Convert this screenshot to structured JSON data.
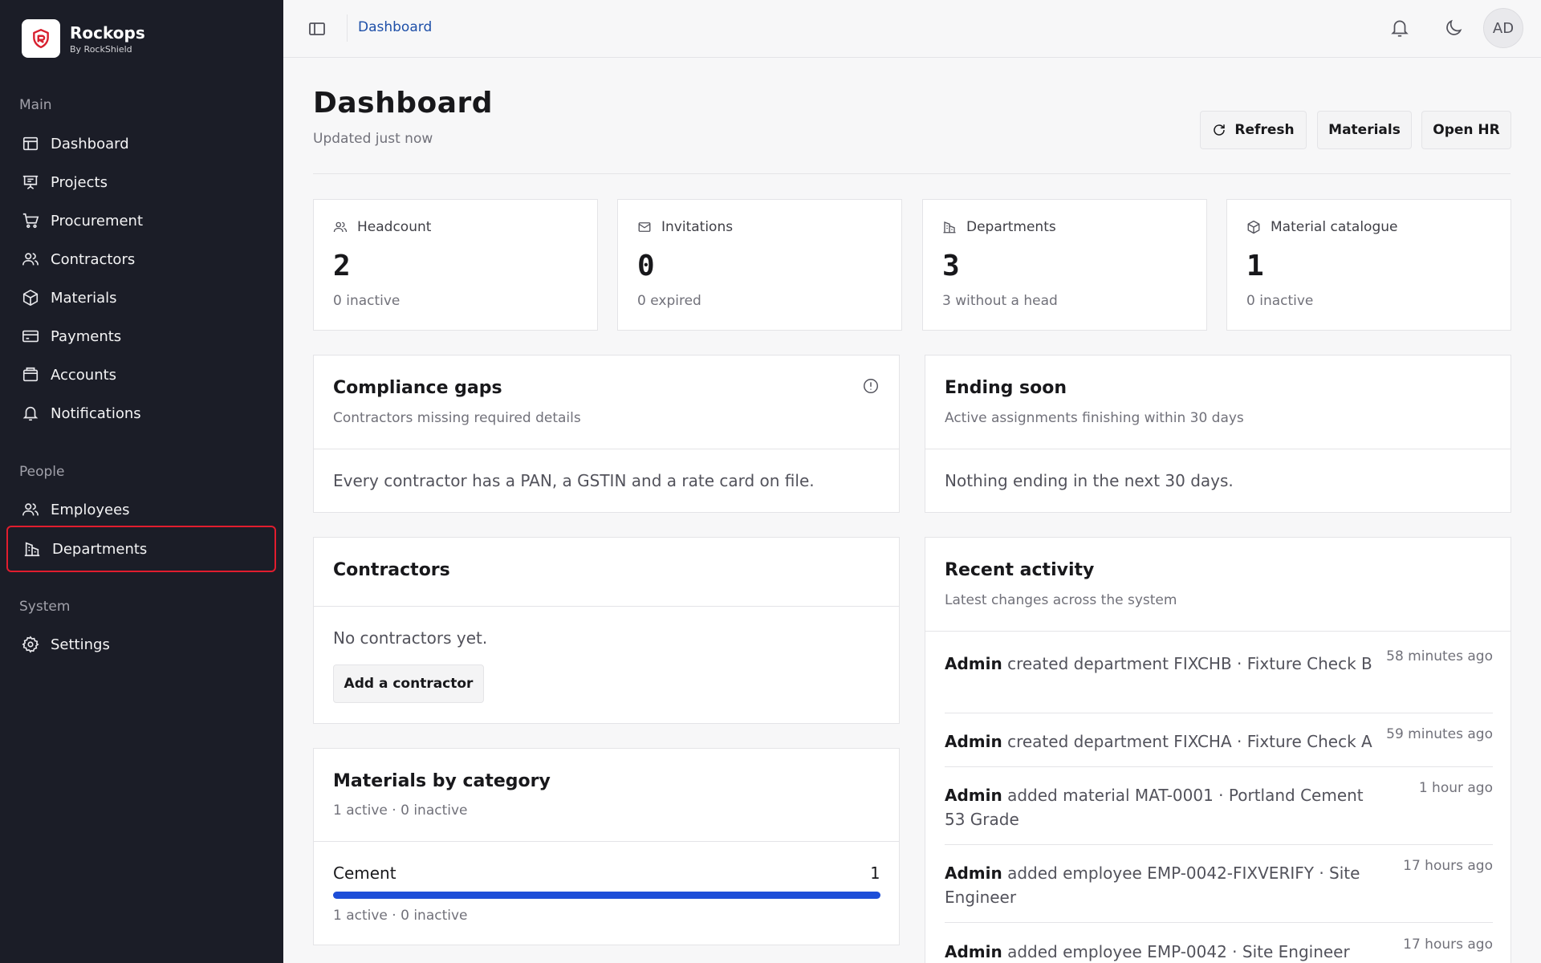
{
  "brand": {
    "name": "Rockops",
    "sub": "By RockShield"
  },
  "sidebar": {
    "sections": [
      {
        "label": "Main"
      },
      {
        "label": "People"
      },
      {
        "label": "System"
      }
    ],
    "items": [
      {
        "label": "Dashboard",
        "icon": "layout-icon"
      },
      {
        "label": "Projects",
        "icon": "presentation-icon"
      },
      {
        "label": "Procurement",
        "icon": "cart-icon"
      },
      {
        "label": "Contractors",
        "icon": "users-icon"
      },
      {
        "label": "Materials",
        "icon": "box-icon"
      },
      {
        "label": "Payments",
        "icon": "card-icon"
      },
      {
        "label": "Accounts",
        "icon": "wallet-icon"
      },
      {
        "label": "Notifications",
        "icon": "bell-icon"
      },
      {
        "label": "Employees",
        "icon": "users-icon"
      },
      {
        "label": "Departments",
        "icon": "building-icon",
        "selected": true
      },
      {
        "label": "Settings",
        "icon": "gear-icon"
      }
    ]
  },
  "topbar": {
    "breadcrumb": "Dashboard",
    "avatar": "AD"
  },
  "header": {
    "title": "Dashboard",
    "subtitle": "Updated just now",
    "buttons": {
      "refresh": "Refresh",
      "materials": "Materials",
      "open_hr": "Open HR"
    }
  },
  "stats": [
    {
      "label": "Headcount",
      "value": "2",
      "note": "0 inactive",
      "icon": "users-icon"
    },
    {
      "label": "Invitations",
      "value": "0",
      "note": "0 expired",
      "icon": "mail-icon"
    },
    {
      "label": "Departments",
      "value": "3",
      "note": "3 without a head",
      "icon": "building-icon"
    },
    {
      "label": "Material catalogue",
      "value": "1",
      "note": "0 inactive",
      "icon": "box-icon"
    }
  ],
  "compliance": {
    "title": "Compliance gaps",
    "subtitle": "Contractors missing required details",
    "body": "Every contractor has a PAN, a GSTIN and a rate card on file."
  },
  "ending": {
    "title": "Ending soon",
    "subtitle": "Active assignments finishing within 30 days",
    "body": "Nothing ending in the next 30 days."
  },
  "contractors": {
    "title": "Contractors",
    "body": "No contractors yet.",
    "button": "Add a contractor"
  },
  "materials": {
    "title": "Materials by category",
    "subtitle": "1 active · 0 inactive",
    "category": {
      "name": "Cement",
      "count": "1",
      "detail": "1 active · 0 inactive",
      "fill": 1.0
    }
  },
  "activity": {
    "title": "Recent activity",
    "subtitle": "Latest changes across the system",
    "rows": [
      {
        "actor": "Admin",
        "text": "created department FIXCHB · Fixture Check B",
        "time": "58 minutes ago"
      },
      {
        "actor": "Admin",
        "text": "created department FIXCHA · Fixture Check A",
        "time": "59 minutes ago"
      },
      {
        "actor": "Admin",
        "text": "added material MAT-0001 · Portland Cement 53 Grade",
        "time": "1 hour ago"
      },
      {
        "actor": "Admin",
        "text": "added employee EMP-0042-FIXVERIFY · Site Engineer",
        "time": "17 hours ago"
      },
      {
        "actor": "Admin",
        "text": "added employee EMP-0042 · Site Engineer",
        "time": "17 hours ago"
      }
    ]
  },
  "colors": {
    "sidebar_bg": "#1b1d27",
    "accent": "#1e4fa8",
    "selected_border": "#e11d2e",
    "progress": "#1d4ed8"
  }
}
